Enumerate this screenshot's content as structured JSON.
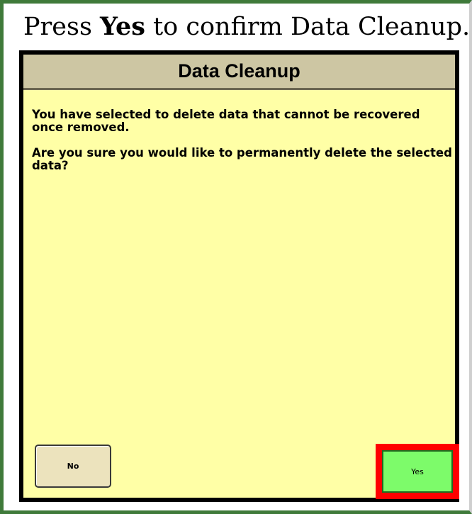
{
  "instruction": {
    "prefix": "Press ",
    "emphasis": "Yes",
    "suffix": " to confirm Data Cleanup."
  },
  "dialog": {
    "title": "Data Cleanup",
    "message_1": "You have selected to delete data that cannot be recovered once removed.",
    "message_2": "Are you sure you would like to permanently delete the selected data?",
    "no_label": "No",
    "yes_label": "Yes"
  },
  "colors": {
    "dialog_background": "#ffffa6",
    "title_bar": "#cdc6a3",
    "no_button": "#ece3bd",
    "yes_button": "#7dfb6a",
    "highlight": "#ff0000",
    "frame_border": "#3f7a3a"
  }
}
